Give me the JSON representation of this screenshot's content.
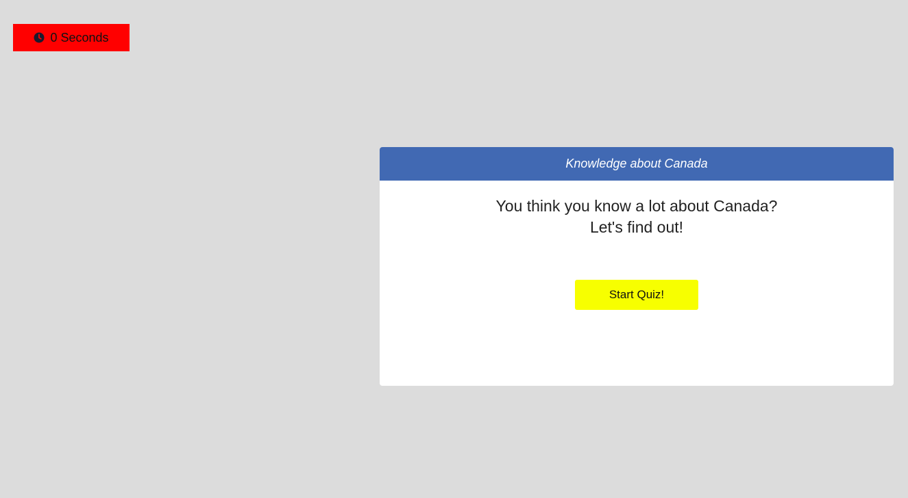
{
  "timer": {
    "icon": "clock-icon",
    "label": "0 Seconds",
    "background": "#ff0000"
  },
  "quiz_card": {
    "header_title": "Knowledge about Canada",
    "header_color": "#4169b3",
    "intro_line_1": "You think you know a lot about Canada?",
    "intro_line_2": "Let's find out!",
    "start_button_label": "Start Quiz!",
    "start_button_color": "#f7ff00"
  },
  "page_background": "#dcdcdc"
}
